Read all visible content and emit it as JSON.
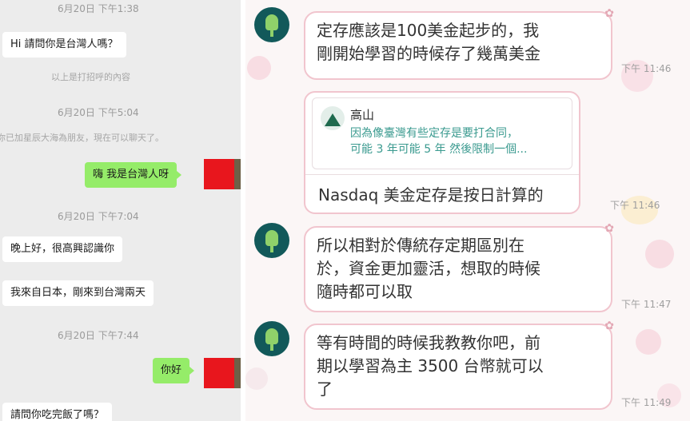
{
  "left_chat": {
    "timestamps": [
      "6月20日 下午1:38",
      "6月20日 下午5:04",
      "6月20日 下午7:04",
      "6月20日 下午7:44"
    ],
    "system_notes": [
      "以上是打招呼的內容",
      "你已加星辰大海為朋友，現在可以聊天了。"
    ],
    "messages": [
      {
        "side": "left",
        "text": "Hi 請問你是台灣人嗎？"
      },
      {
        "side": "right",
        "text": "嗨 我是台灣人呀"
      },
      {
        "side": "left",
        "text": "晚上好，很高興認識你"
      },
      {
        "side": "left",
        "text": "我來自日本，剛來到台灣兩天"
      },
      {
        "side": "right",
        "text": "你好"
      },
      {
        "side": "left",
        "text": "請問你吃完飯了嗎？"
      }
    ]
  },
  "right_chat": {
    "messages": [
      {
        "lines": [
          "定存應該是100美金起步的，我",
          "剛開始學習的時候存了幾萬美金"
        ],
        "time": "下午 11:46"
      },
      {
        "lines": [
          "所以相對於傳統存定期區別在",
          "於，資金更加靈活，想取的時候",
          "隨時都可以取"
        ],
        "time": "下午 11:47"
      },
      {
        "lines": [
          "等有時間的時候我教教你吧，前",
          "期以學習為主 3500 台幣就可以",
          "了"
        ],
        "time": "下午 11:49"
      }
    ],
    "reply": {
      "quoted_name": "高山",
      "quoted_lines": [
        "因為像臺灣有些定存是要打合同，",
        "可能 3 年可能 5 年 然後限制一個..."
      ],
      "text": "Nasdaq 美金定存是按日計算的",
      "time": "下午 11:46"
    }
  },
  "colors": {
    "left_bg": "#ececec",
    "sent_bubble": "#95ec69",
    "received_bubble": "#ffffff",
    "right_border": "#f1c5ce",
    "avatar_bg": "#12595a",
    "quote_text": "#3a9a8f",
    "redaction": "#e8161d"
  }
}
